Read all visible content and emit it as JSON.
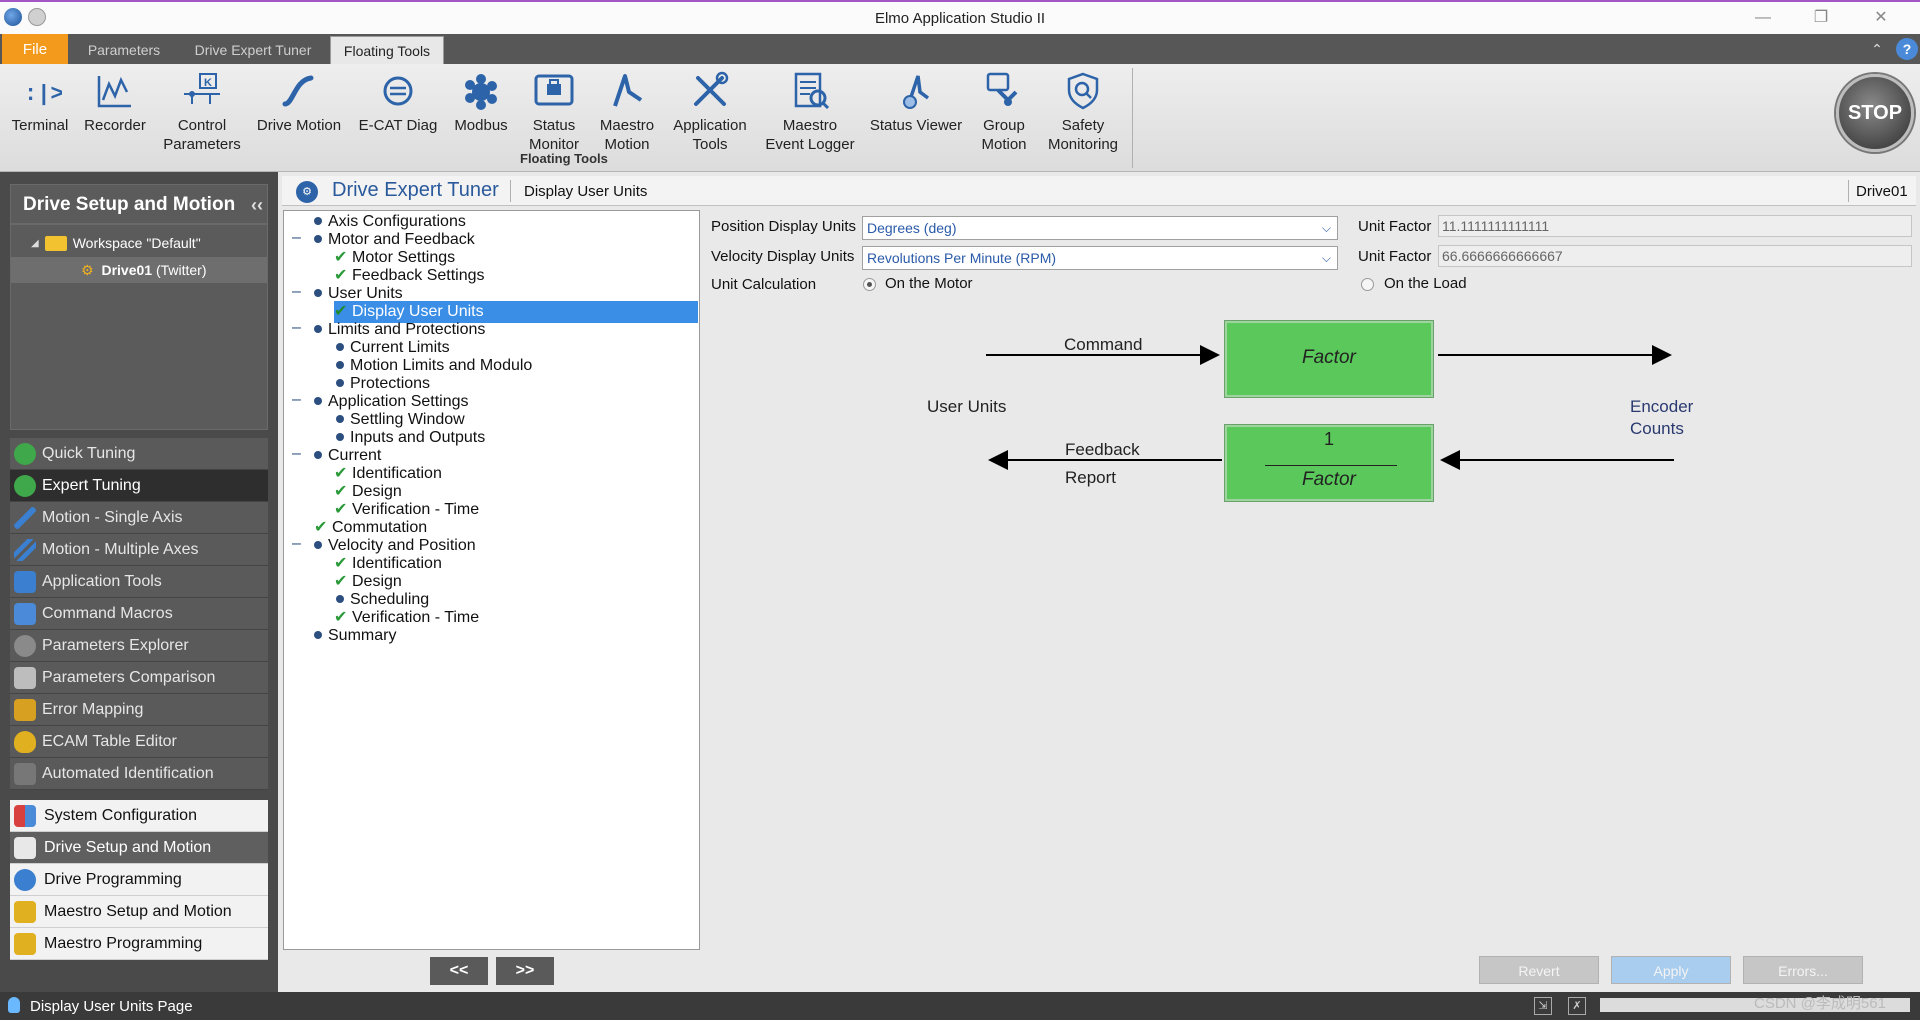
{
  "app": {
    "title": "Elmo Application Studio II"
  },
  "ribbon_tabs": [
    {
      "label": "File"
    },
    {
      "label": "Parameters"
    },
    {
      "label": "Drive Expert Tuner"
    },
    {
      "label": "Floating Tools"
    }
  ],
  "ribbon": {
    "buttons": [
      {
        "label": "Terminal",
        "icon": "terminal-icon"
      },
      {
        "label": "Recorder",
        "icon": "recorder-icon"
      },
      {
        "label": "Control\nParameters",
        "icon": "control-parameters-icon"
      },
      {
        "label": "Drive Motion",
        "icon": "drive-motion-icon"
      },
      {
        "label": "E-CAT Diag",
        "icon": "ecat-diag-icon"
      },
      {
        "label": "Modbus",
        "icon": "modbus-icon"
      },
      {
        "label": "Status\nMonitor",
        "icon": "status-monitor-icon"
      },
      {
        "label": "Maestro\nMotion",
        "icon": "maestro-motion-icon"
      },
      {
        "label": "Application\nTools",
        "icon": "application-tools-icon"
      },
      {
        "label": "Maestro\nEvent Logger",
        "icon": "event-logger-icon"
      },
      {
        "label": "Status Viewer",
        "icon": "status-viewer-icon"
      },
      {
        "label": "Group\nMotion",
        "icon": "group-motion-icon"
      },
      {
        "label": "Safety\nMonitoring",
        "icon": "safety-monitoring-icon"
      }
    ],
    "group_label": "Floating Tools",
    "stop_label": "STOP"
  },
  "left_panel": {
    "header": "Drive Setup and Motion",
    "collapse_glyph": "‹‹",
    "workspace_label": "Workspace \"Default\"",
    "drive_name": "Drive01",
    "drive_suffix": "(Twitter)",
    "tools": [
      {
        "label": "Quick Tuning",
        "color": "#3fa84a"
      },
      {
        "label": "Expert Tuning",
        "color": "#3fa84a"
      },
      {
        "label": "Motion - Single Axis",
        "color": "#3a7fd0"
      },
      {
        "label": "Motion - Multiple Axes",
        "color": "#3a7fd0"
      },
      {
        "label": "Application Tools",
        "color": "#3a7fd0"
      },
      {
        "label": "Command Macros",
        "color": "#4a8ad8"
      },
      {
        "label": "Parameters Explorer",
        "color": "#8a8a8a"
      },
      {
        "label": "Parameters Comparison",
        "color": "#9a9a9a"
      },
      {
        "label": "Error Mapping",
        "color": "#d8a020"
      },
      {
        "label": "ECAM Table Editor",
        "color": "#e0b020"
      },
      {
        "label": "Automated Identification",
        "color": "#6a6a6a"
      }
    ],
    "nav": [
      {
        "label": "System Configuration",
        "color": "#d84040"
      },
      {
        "label": "Drive Setup and Motion",
        "color": "#e8e8e8"
      },
      {
        "label": "Drive Programming",
        "color": "#3a7fd0"
      },
      {
        "label": "Maestro Setup and Motion",
        "color": "#e0b020"
      },
      {
        "label": "Maestro Programming",
        "color": "#e0b020"
      }
    ]
  },
  "content_header": {
    "title": "Drive Expert Tuner",
    "page": "Display User Units",
    "drive": "Drive01"
  },
  "tree": [
    {
      "label": "Axis Configurations",
      "mark": "bullet",
      "level": 0
    },
    {
      "label": "Motor and Feedback",
      "mark": "bullet",
      "level": 0,
      "expanded": true
    },
    {
      "label": "Motor Settings",
      "mark": "check",
      "level": 1
    },
    {
      "label": "Feedback Settings",
      "mark": "check",
      "level": 1
    },
    {
      "label": "User Units",
      "mark": "bullet",
      "level": 0,
      "expanded": true
    },
    {
      "label": "Display User Units",
      "mark": "check",
      "level": 1,
      "selected": true
    },
    {
      "label": "Limits and Protections",
      "mark": "bullet",
      "level": 0,
      "expanded": true
    },
    {
      "label": "Current Limits",
      "mark": "bullet",
      "level": 1
    },
    {
      "label": "Motion Limits and Modulo",
      "mark": "bullet",
      "level": 1
    },
    {
      "label": "Protections",
      "mark": "bullet",
      "level": 1
    },
    {
      "label": "Application Settings",
      "mark": "bullet",
      "level": 0,
      "expanded": true
    },
    {
      "label": "Settling Window",
      "mark": "bullet",
      "level": 1
    },
    {
      "label": "Inputs and Outputs",
      "mark": "bullet",
      "level": 1
    },
    {
      "label": "Current",
      "mark": "bullet",
      "level": 0,
      "expanded": true
    },
    {
      "label": "Identification",
      "mark": "check",
      "level": 1
    },
    {
      "label": "Design",
      "mark": "check",
      "level": 1
    },
    {
      "label": "Verification - Time",
      "mark": "check",
      "level": 1
    },
    {
      "label": "Commutation",
      "mark": "check",
      "level": 0
    },
    {
      "label": "Velocity and Position",
      "mark": "bullet",
      "level": 0,
      "expanded": true
    },
    {
      "label": "Identification",
      "mark": "check",
      "level": 1
    },
    {
      "label": "Design",
      "mark": "check",
      "level": 1
    },
    {
      "label": "Scheduling",
      "mark": "bullet",
      "level": 1
    },
    {
      "label": "Verification - Time",
      "mark": "check",
      "level": 1
    },
    {
      "label": "Summary",
      "mark": "bullet",
      "level": 0
    }
  ],
  "tree_nav": {
    "prev": "<<",
    "next": ">>"
  },
  "form": {
    "position_label": "Position Display Units",
    "position_value": "Degrees (deg)",
    "velocity_label": "Velocity Display Units",
    "velocity_value": "Revolutions Per Minute (RPM)",
    "unit_factor_label": "Unit Factor",
    "position_factor": "11.1111111111111",
    "velocity_factor": "66.6666666666667",
    "unit_calc_label": "Unit Calculation",
    "on_motor": "On the Motor",
    "on_load": "On the Load",
    "selected_calc": "On the Motor"
  },
  "diagram": {
    "command": "Command",
    "factor": "Factor",
    "one": "1",
    "user_units": "User Units",
    "encoder": "Encoder",
    "counts": "Counts",
    "feedback": "Feedback",
    "report": "Report",
    "box_color": "#5ac85a"
  },
  "buttons": {
    "revert": "Revert",
    "apply": "Apply",
    "errors": "Errors..."
  },
  "status": {
    "text": "Display User Units Page",
    "watermark": "CSDN @李成明561"
  }
}
